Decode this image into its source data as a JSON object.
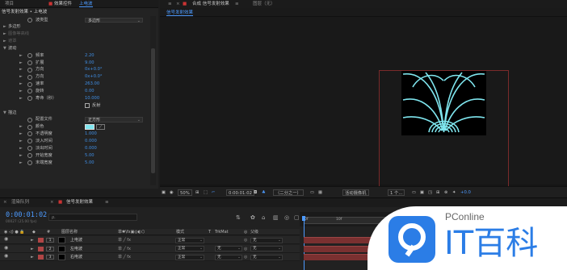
{
  "left_panel": {
    "tabs": [
      {
        "label": "项目",
        "active": false
      },
      {
        "label": "效果控件",
        "active": false
      },
      {
        "label": "上电波",
        "active": true
      }
    ],
    "effect_title": "信号发射效果 • 上电波",
    "rows": [
      {
        "type": "dropdown",
        "label": "波类型",
        "value": "多边形"
      },
      {
        "type": "group",
        "label": "多边形",
        "dim": false
      },
      {
        "type": "group",
        "label": "图像等高线",
        "dim": true
      },
      {
        "type": "group",
        "label": "遮罩",
        "dim": true
      },
      {
        "type": "group",
        "label": "波动",
        "dim": false,
        "open": true
      },
      {
        "type": "prop",
        "label": "频率",
        "value": "2.20"
      },
      {
        "type": "prop",
        "label": "扩展",
        "value": "9.00"
      },
      {
        "type": "prop",
        "label": "方向",
        "value": "0x+0.0°"
      },
      {
        "type": "prop",
        "label": "方向",
        "value": "0x+0.0°"
      },
      {
        "type": "prop",
        "label": "速率",
        "value": "263.00"
      },
      {
        "type": "prop",
        "label": "旋转",
        "value": "0.00"
      },
      {
        "type": "prop",
        "label": "寿命（秒）",
        "value": "10.000"
      },
      {
        "type": "checkbox",
        "label": "反射"
      },
      {
        "type": "group",
        "label": "描边",
        "dim": false,
        "open": true
      },
      {
        "type": "dropdown",
        "label": "配置文件",
        "value": "正方形"
      },
      {
        "type": "color",
        "label": "颜色",
        "value": "#7fe6ef"
      },
      {
        "type": "prop",
        "label": "不透明度",
        "value": "1.000"
      },
      {
        "type": "prop",
        "label": "淡入时间",
        "value": "0.000"
      },
      {
        "type": "prop",
        "label": "淡出时间",
        "value": "0.000"
      },
      {
        "type": "prop",
        "label": "开始宽度",
        "value": "5.00"
      },
      {
        "type": "prop",
        "label": "末端宽度",
        "value": "5.00"
      }
    ]
  },
  "comp_panel": {
    "tab_label": "合成 信号发射效果",
    "layer_tab": "图层（无）",
    "subtab": "信号发射效果"
  },
  "viewer_toolbar": {
    "zoom": "50%",
    "timecode": "0:00:01:02",
    "resolution": "（二分之一）",
    "camera": "活动摄像机",
    "views": "1 个...",
    "exposure": "+0.0"
  },
  "timeline": {
    "tabs": [
      {
        "label": "渲染队列",
        "active": false
      },
      {
        "label": "信号发射效果",
        "active": true
      }
    ],
    "timecode": "0:00:01:02",
    "fps": "00027 (25.00 fps)",
    "search_placeholder": "ρ.",
    "ruler_labels": [
      "0f",
      "10f"
    ],
    "headers": {
      "source_name": "图层名称",
      "switches": "单✱\\fx▣◎◐⬡",
      "mode": "模式",
      "t": "T",
      "trkmat": "TrkMat",
      "parent": "父级"
    },
    "layers": [
      {
        "num": "1",
        "name": "上电波",
        "mode": "正常",
        "trkmat": "",
        "parent": "无"
      },
      {
        "num": "2",
        "name": "左电波",
        "mode": "正常",
        "trkmat": "无",
        "parent": "无"
      },
      {
        "num": "3",
        "name": "右电波",
        "mode": "正常",
        "trkmat": "无",
        "parent": "无"
      }
    ]
  },
  "watermark": {
    "brand": "PConline",
    "name": "IT百科"
  },
  "colors": {
    "accent": "#4d9bff",
    "wave_stroke": "#7fe6ef",
    "layer_bar": "#7a3030"
  }
}
